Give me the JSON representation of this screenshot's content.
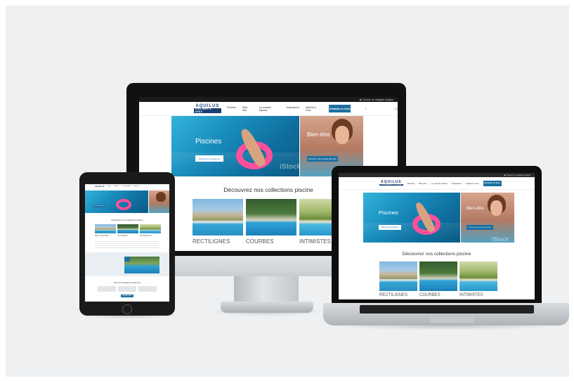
{
  "site": {
    "brand": "AQUILUS",
    "brand_sub": "PISCINES & SPAS",
    "store_finder": "Trouver un magasin Aquilus",
    "nav_items": [
      "Piscines",
      "Bien-être",
      "La marque Aquilus",
      "Inspirations",
      "Aquilus & vous"
    ],
    "cta": "Demander un devis",
    "hero_left": {
      "title": "Piscines",
      "button": "Découvrir nos piscines"
    },
    "hero_right": {
      "title": "Bien-être",
      "button": "Découvrir nos produits bien-être"
    },
    "watermark": "iStock",
    "collections_title": "Découvrez nos collections piscine",
    "collections": [
      "RECTILIGNES",
      "COURBES",
      "INTIMISTES"
    ],
    "employees_title": "Tous nos employés sont des pros",
    "cart": "0"
  },
  "colors": {
    "brand_blue": "#1a3f73",
    "cta_blue": "#1c6fa3",
    "backdrop": "#eef0f2"
  },
  "devices": [
    "desktop-monitor",
    "tablet",
    "laptop"
  ]
}
